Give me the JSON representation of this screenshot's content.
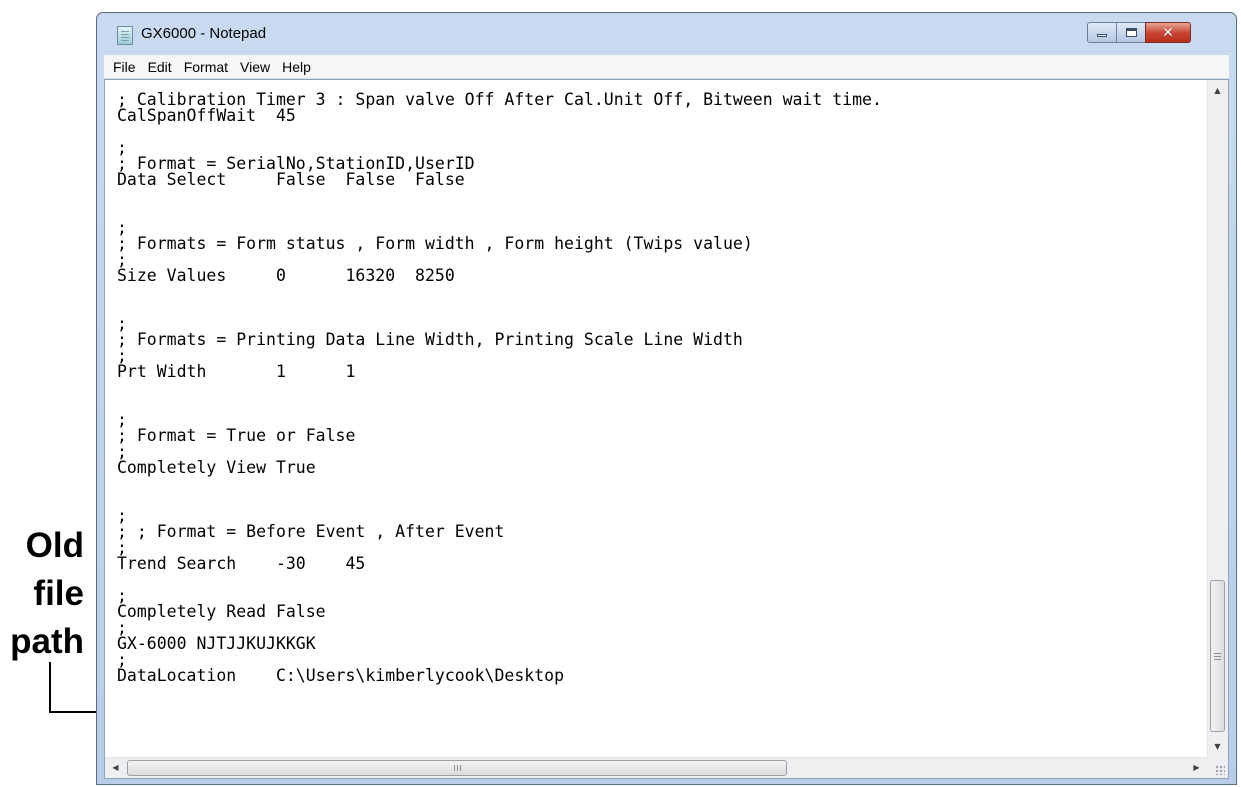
{
  "callout": {
    "lines": [
      "Old",
      "file",
      "path"
    ]
  },
  "window": {
    "title": "GX6000 - Notepad",
    "controls": {
      "minimize": "minimize",
      "maximize": "maximize",
      "close": "close"
    }
  },
  "menu": {
    "items": [
      "File",
      "Edit",
      "Format",
      "View",
      "Help"
    ]
  },
  "editor": {
    "lines": [
      "; Calibration Timer 3 : Span valve Off After Cal.Unit Off, Bitween wait time.",
      "CalSpanOffWait  45",
      "",
      ";",
      "; Format = SerialNo,StationID,UserID",
      "Data Select     False  False  False",
      "",
      "",
      ";",
      "; Formats = Form status , Form width , Form height (Twips value)",
      ";",
      "Size Values     0      16320  8250",
      "",
      "",
      ";",
      "; Formats = Printing Data Line Width, Printing Scale Line Width",
      ";",
      "Prt Width       1      1",
      "",
      "",
      ";",
      "; Format = True or False",
      ";",
      "Completely View True",
      "",
      "",
      ";",
      "; ; Format = Before Event , After Event",
      ";",
      "Trend Search    -30    45",
      "",
      ";",
      "Completely Read False",
      ";",
      "GX-6000 NJTJJKUJKKGK",
      ";",
      "DataLocation    C:\\Users\\kimberlycook\\Desktop"
    ]
  },
  "scrollbars": {
    "hscroll_grip": "III"
  }
}
